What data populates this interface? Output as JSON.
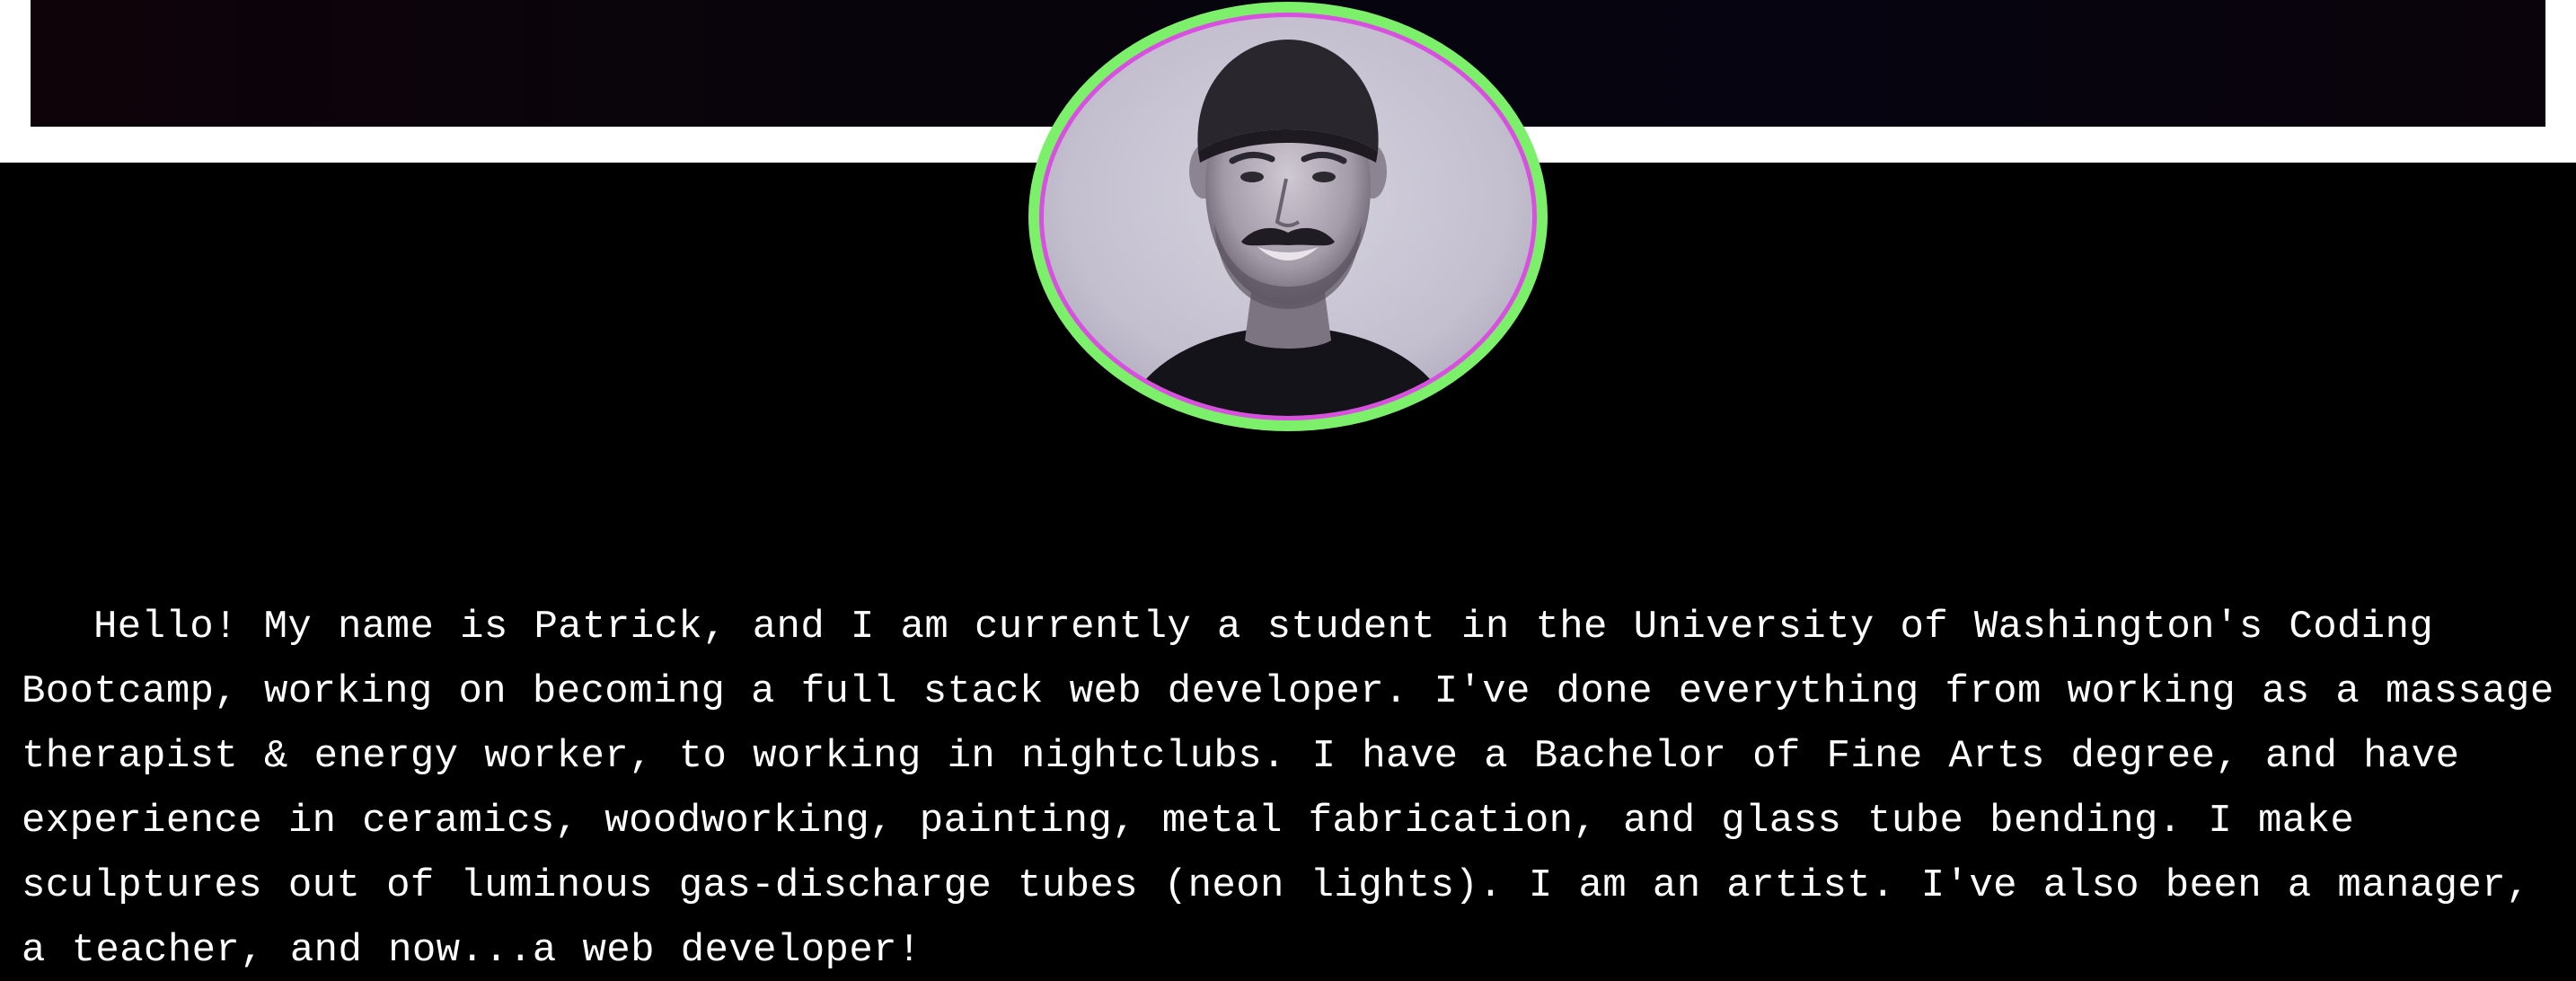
{
  "header": {
    "banner_color": "#080410",
    "strip_color": "#ffffff"
  },
  "profile": {
    "avatar_alt": "Portrait photo of Patrick",
    "ring_outer_color": "#7cf06a",
    "ring_inner_color": "#d94fe0"
  },
  "about": {
    "bio_text": "Hello! My name is Patrick, and I am currently a student in the University of Washington's Coding Bootcamp, working on becoming a full stack web developer. I've done everything from working as a massage therapist & energy worker, to working in nightclubs. I have a Bachelor of Fine Arts degree, and have experience in ceramics, woodworking, painting, metal fabrication, and glass tube bending. I make sculptures out of luminous gas-discharge tubes (neon lights). I am an artist. I've also been a manager, a teacher, and now...a web developer!"
  }
}
